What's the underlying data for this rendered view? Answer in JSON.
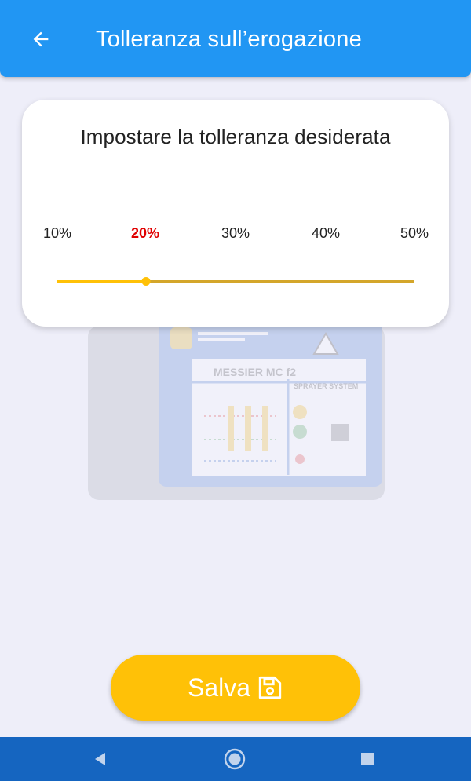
{
  "appbar": {
    "title": "Tolleranza sull’erogazione",
    "back_icon": "arrow-left-icon",
    "color": "#2196f3"
  },
  "card": {
    "title": "Impostare la tolleranza desiderata",
    "ticks": [
      "10%",
      "20%",
      "30%",
      "40%",
      "50%"
    ],
    "selected_index": 1,
    "selected_value": "20%",
    "selected_color": "#e00000"
  },
  "slider": {
    "min": 10,
    "max": 50,
    "value": 20,
    "fill_color": "#ffc107",
    "track_color": "#d4a62a"
  },
  "background_image": {
    "device_label": "MESSIER MC f2",
    "device_sublabel": "SPRAYER SYSTEM"
  },
  "save_button": {
    "label": "Salva",
    "icon": "floppy-disk-icon",
    "color": "#ffc107"
  },
  "navbar": {
    "color": "#1565c0",
    "icons": [
      "back-triangle-icon",
      "home-circle-icon",
      "recents-square-icon"
    ]
  }
}
